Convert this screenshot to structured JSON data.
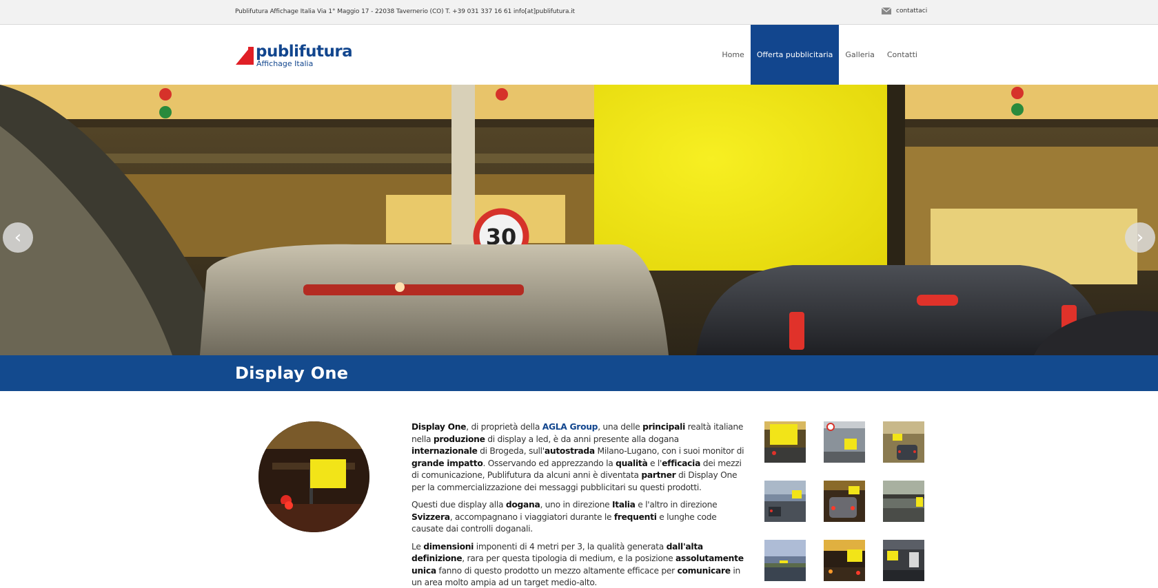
{
  "topbar": {
    "info": "Publifutura Affichage Italia Via 1° Maggio 17 - 22038 Tavernerio (CO) T. +39 031 337 16 61 info[at]publifutura.it",
    "contact_label": "contattaci"
  },
  "logo": {
    "name": "publifutura",
    "sub": "Affichage Italia"
  },
  "nav": {
    "items": [
      {
        "label": "Home",
        "active": false
      },
      {
        "label": "Offerta pubblicitaria",
        "active": true
      },
      {
        "label": "Galleria",
        "active": false
      },
      {
        "label": "Contatti",
        "active": false
      }
    ]
  },
  "hero": {
    "prev_arrow": "‹",
    "next_arrow": "›",
    "speed_sign": "30"
  },
  "page_title": "Display One",
  "content": {
    "p1": [
      {
        "t": "Display One",
        "b": true
      },
      {
        "t": ", di proprietà della "
      },
      {
        "t": "AGLA Group",
        "brand": true
      },
      {
        "t": ", una delle "
      },
      {
        "t": "principali",
        "b": true
      },
      {
        "t": " realtà italiane nella "
      },
      {
        "t": "produzione",
        "b": true
      },
      {
        "t": " di display a led, è da anni presente alla dogana "
      },
      {
        "t": "internazionale",
        "b": true
      },
      {
        "t": " di Brogeda, sull'"
      },
      {
        "t": "autostrada",
        "b": true
      },
      {
        "t": " Milano-Lugano, con i suoi monitor di "
      },
      {
        "t": "grande impatto",
        "b": true
      },
      {
        "t": ". Osservando ed apprezzando la "
      },
      {
        "t": "qualità",
        "b": true
      },
      {
        "t": " e l'"
      },
      {
        "t": "efficacia",
        "b": true
      },
      {
        "t": " dei mezzi di comunicazione, Publifutura da alcuni anni è diventata "
      },
      {
        "t": "partner",
        "b": true
      },
      {
        "t": " di Display One per la commercializzazione dei messaggi pubblicitari su questi prodotti."
      }
    ],
    "p2": [
      {
        "t": "Questi due display alla "
      },
      {
        "t": "dogana",
        "b": true
      },
      {
        "t": ", uno in direzione "
      },
      {
        "t": "Italia",
        "b": true
      },
      {
        "t": " e l'altro in direzione "
      },
      {
        "t": "Svizzera",
        "b": true
      },
      {
        "t": ", accompagnano i viaggiatori durante le "
      },
      {
        "t": "frequenti",
        "b": true
      },
      {
        "t": " e lunghe code causate dai controlli doganali."
      }
    ],
    "p3": [
      {
        "t": "Le "
      },
      {
        "t": "dimensioni",
        "b": true
      },
      {
        "t": " imponenti di 4 metri per 3, la qualità generata "
      },
      {
        "t": "dall'alta definizione",
        "b": true
      },
      {
        "t": ", rara per questa tipologia di medium, e la posizione "
      },
      {
        "t": "assolutamente unica",
        "b": true
      },
      {
        "t": " fanno di questo prodotto un mezzo altamente efficace per "
      },
      {
        "t": "comunicare",
        "b": true
      },
      {
        "t": " in un area molto ampia ad un target medio-alto."
      }
    ]
  },
  "colors": {
    "brand_blue": "#134a8e",
    "topbar_bg": "#f2f2f2",
    "billboard_yellow": "#f4ec1a"
  }
}
